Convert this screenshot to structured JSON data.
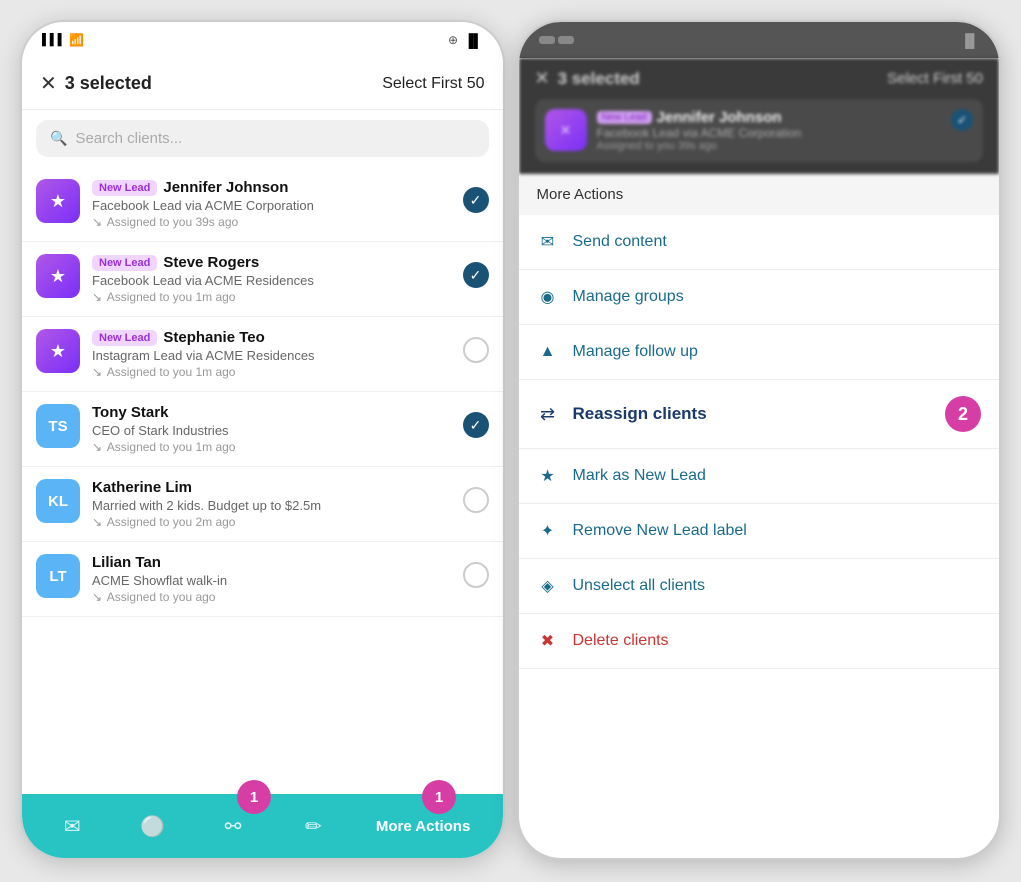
{
  "left_phone": {
    "status_bar": {
      "signal": "📶",
      "wifi": "WiFi",
      "charge_icon": "⊕",
      "battery": "🔋"
    },
    "top_bar": {
      "close": "✕",
      "selected_count": "3 selected",
      "select_first": "Select First 50"
    },
    "search": {
      "placeholder": "Search clients..."
    },
    "clients": [
      {
        "type": "new_lead",
        "badge": "New Lead",
        "name": "Jennifer Johnson",
        "desc": "Facebook Lead via ACME Corporation",
        "assigned": "Assigned to you 39s ago",
        "avatar_type": "star",
        "checked": true
      },
      {
        "type": "new_lead",
        "badge": "New Lead",
        "name": "Steve Rogers",
        "desc": "Facebook Lead via ACME Residences",
        "assigned": "Assigned to you 1m ago",
        "avatar_type": "star",
        "checked": true
      },
      {
        "type": "new_lead",
        "badge": "New Lead",
        "name": "Stephanie Teo",
        "desc": "Instagram Lead via ACME Residences",
        "assigned": "Assigned to you 1m ago",
        "avatar_type": "star",
        "checked": false
      },
      {
        "type": "contact",
        "initials": "TS",
        "name": "Tony Stark",
        "desc": "CEO of Stark Industries",
        "assigned": "Assigned to you 1m ago",
        "avatar_color": "blue",
        "checked": true
      },
      {
        "type": "contact",
        "initials": "KL",
        "name": "Katherine Lim",
        "desc": "Married with 2 kids. Budget up to $2.5m",
        "assigned": "Assigned to you 2m ago",
        "avatar_color": "blue",
        "checked": false
      },
      {
        "type": "contact",
        "initials": "LT",
        "name": "Lilian Tan",
        "desc": "ACME Showflat walk-in",
        "assigned": "Assigned to you ago",
        "avatar_color": "blue",
        "checked": false
      }
    ],
    "bottom_bar": {
      "more_actions": "More Actions",
      "badge_number": "1"
    }
  },
  "right_panel": {
    "blurred_header": {
      "close": "✕",
      "selected_count": "3 selected",
      "select_first": "Select First 50",
      "client_name": "Jennifer Johnson",
      "client_badge": "New Lead",
      "client_desc": "Facebook Lead via ACME Corporation",
      "client_assigned": "Assigned to you 39s ago"
    },
    "more_actions_header": "More Actions",
    "actions": [
      {
        "icon": "✉",
        "label": "Send content"
      },
      {
        "icon": "◉",
        "label": "Manage groups"
      },
      {
        "icon": "▲",
        "label": "Manage follow up"
      },
      {
        "icon": "⇄",
        "label": "Reassign clients",
        "highlighted": true,
        "badge": "2"
      },
      {
        "icon": "★",
        "label": "Mark as New Lead"
      },
      {
        "icon": "✦",
        "label": "Remove New Lead label"
      },
      {
        "icon": "◈",
        "label": "Unselect all clients"
      },
      {
        "icon": "✖",
        "label": "Delete clients"
      }
    ]
  }
}
